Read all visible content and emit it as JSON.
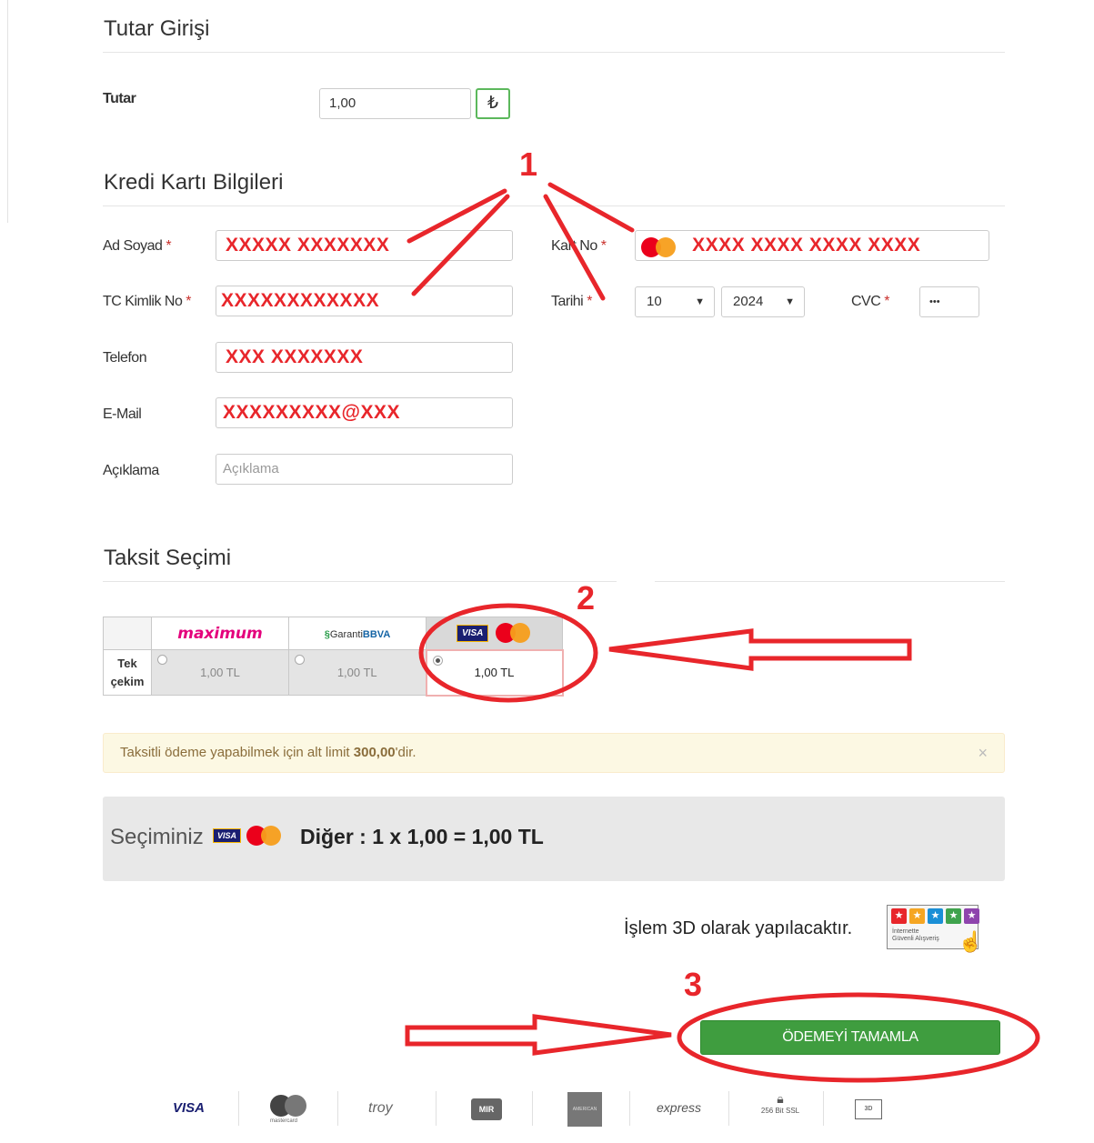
{
  "amount_section": {
    "title": "Tutar Girişi",
    "amount_label": "Tutar",
    "amount_value": "1,00",
    "currency_symbol": "₺"
  },
  "card_section": {
    "title": "Kredi Kartı Bilgileri",
    "name_label": "Ad Soyad",
    "name_value": "XXXXX XXXXXXX",
    "tc_label": "TC Kimlik No",
    "tc_value": "XXXXXXXXXXXX",
    "phone_label": "Telefon",
    "phone_value": "XXX XXXXXXX",
    "email_label": "E-Mail",
    "email_value": "XXXXXXXXX@XXX",
    "desc_label": "Açıklama",
    "desc_placeholder": "Açıklama",
    "card_no_label": "Kart No",
    "card_no_value": "XXXX XXXX XXXX XXXX",
    "date_label": "Tarihi",
    "month_value": "10",
    "year_value": "2024",
    "cvc_label": "CVC",
    "cvc_value": "•••",
    "required_mark": "*",
    "brand_mc": "MasterCard",
    "brand_visa": "VISA"
  },
  "installment_section": {
    "title": "Taksit Seçimi",
    "row_label_1": "Tek",
    "row_label_2": "çekim",
    "banks": [
      {
        "name": "maximum",
        "amount": "1,00 TL",
        "selected": false
      },
      {
        "name": "GarantiBBVA",
        "amount": "1,00 TL",
        "selected": false
      },
      {
        "name": "VISA/MasterCard",
        "amount": "1,00 TL",
        "selected": true
      }
    ]
  },
  "alert": {
    "text_before": "Taksitli ödeme yapabilmek için alt limit ",
    "limit": "300,00",
    "text_after": "'dir.",
    "close": "×"
  },
  "selection": {
    "label": "Seçiminiz",
    "summary": "Diğer : 1 x 1,00 = 1,00 TL"
  },
  "secure_3d": {
    "text": "İşlem 3D olarak yapılacaktır.",
    "badge_line1": "İnternette",
    "badge_line2": "Güvenli Alışveriş"
  },
  "pay_button": {
    "label": "ÖDEMEYİ TAMAMLA"
  },
  "annotations": {
    "one": "1",
    "two": "2",
    "three": "3"
  },
  "footer_logos": [
    "VISA",
    "mastercard",
    "troy",
    "MIR",
    "AMERICAN EXPRESS",
    "express",
    "256 Bit SSL",
    "3D SECURE"
  ],
  "colors": {
    "annotation_red": "#e8262b",
    "pay_green": "#3f9d3f",
    "alert_bg": "#fcf8e3"
  }
}
